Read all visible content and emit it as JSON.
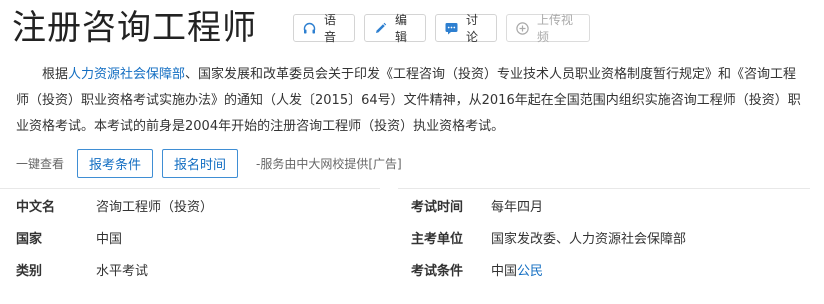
{
  "title": "注册咨询工程师",
  "toolbar": {
    "voice": "语音",
    "edit": "编辑",
    "discuss": "讨论",
    "upload": "上传视频"
  },
  "intro": {
    "p1": "根据",
    "link1": "人力资源社会保障部",
    "p2": "、国家发展和改革委员会关于印发《工程咨询（投资）专业技术人员职业资格制度暂行规定》和《咨询工程师（投资）职业资格考试实施办法》的通知（人发〔2015〕64号）文件精神，从2016年起在全国范围内组织实施咨询工程师（投资）职业资格考试。本考试的前身是2004年开始的注册咨询工程师（投资）执业资格考试。"
  },
  "quick": {
    "label": "一键查看",
    "buttons": [
      "报考条件",
      "报名时间"
    ],
    "ad": "-服务由中大网校提供[广告]"
  },
  "info_left": [
    {
      "key": "中文名",
      "value": "咨询工程师（投资）"
    },
    {
      "key": "国家",
      "value": "中国"
    },
    {
      "key": "类别",
      "value": "水平考试"
    }
  ],
  "info_right": [
    {
      "key": "考试时间",
      "value": "每年四月"
    },
    {
      "key": "主考单位",
      "value": "国家发改委、人力资源社会保障部"
    },
    {
      "key": "考试条件",
      "value": "中国",
      "link": "公民"
    }
  ],
  "icons": {
    "voice": "headphones-icon",
    "edit": "pencil-icon",
    "discuss": "chat-icon",
    "upload": "plus-circle-icon"
  },
  "colors": {
    "link": "#136ec2",
    "accent_button": "#2d7fd0"
  }
}
